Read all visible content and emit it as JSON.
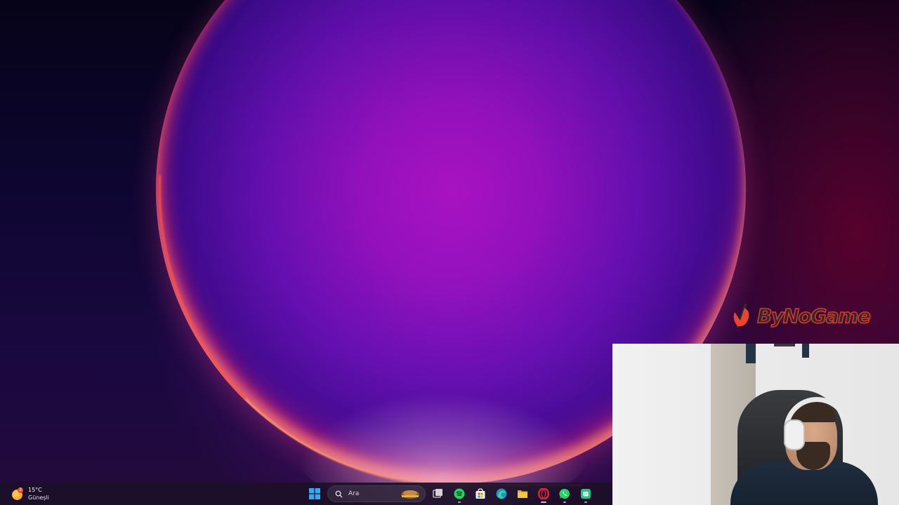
{
  "desktop": {
    "wallpaper": "windows-11-bloom-purple",
    "accent_colors": [
      "#b313c9",
      "#3b0b8e",
      "#ff5046",
      "#6e0028"
    ]
  },
  "brand_overlay": {
    "text": "ByNoGame",
    "color": "#d93a2b"
  },
  "webcam": {
    "description_icon": "webcam-feed"
  },
  "taskbar": {
    "weather": {
      "temperature": "15°C",
      "condition": "Güneşli",
      "badge": "3",
      "icon": "sun-icon"
    },
    "search": {
      "placeholder": "Ara",
      "icon": "search-icon"
    },
    "pinned": [
      {
        "name": "start",
        "icon": "windows-logo-icon"
      },
      {
        "name": "task-view",
        "icon": "task-view-icon"
      },
      {
        "name": "spotify",
        "icon": "spotify-icon",
        "color": "#1ed760"
      },
      {
        "name": "microsoft-store",
        "icon": "store-icon"
      },
      {
        "name": "edge",
        "icon": "edge-icon"
      },
      {
        "name": "file-explorer",
        "icon": "folder-icon"
      },
      {
        "name": "opera-gx",
        "icon": "opera-icon",
        "color": "#e3263a"
      },
      {
        "name": "whatsapp",
        "icon": "whatsapp-icon",
        "color": "#25d366"
      },
      {
        "name": "app",
        "icon": "app-icon",
        "color": "#27c28a"
      }
    ]
  }
}
